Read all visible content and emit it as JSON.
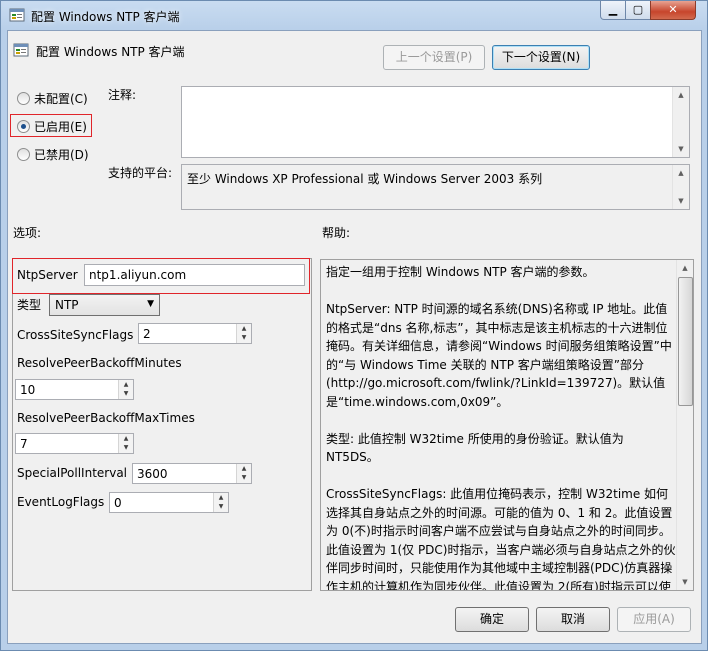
{
  "window": {
    "title": "配置 Windows NTP 客户端",
    "icon": "policy-settings-icon",
    "caption_buttons": {
      "minimize": "▁",
      "maximize": "▢",
      "close": "✕"
    }
  },
  "header": {
    "heading": "配置 Windows NTP 客户端",
    "prev_setting": "上一个设置(P)",
    "next_setting": "下一个设置(N)"
  },
  "state": {
    "not_configured": "未配置(C)",
    "enabled": "已启用(E)",
    "disabled": "已禁用(D)",
    "selected": "enabled"
  },
  "comment": {
    "label": "注释:",
    "value": ""
  },
  "platform": {
    "label": "支持的平台:",
    "value": "至少 Windows XP Professional 或 Windows Server 2003 系列"
  },
  "options": {
    "label": "选项:",
    "ntp_server": {
      "label": "NtpServer",
      "value": "ntp1.aliyun.com"
    },
    "type": {
      "label": "类型",
      "value": "NTP"
    },
    "cross_site_sync_flags": {
      "label": "CrossSiteSyncFlags",
      "value": "2"
    },
    "resolve_peer_backoff_minutes": {
      "label": "ResolvePeerBackoffMinutes",
      "value": "10"
    },
    "resolve_peer_backoff_max_times": {
      "label": "ResolvePeerBackoffMaxTimes",
      "value": "7"
    },
    "special_poll_interval": {
      "label": "SpecialPollInterval",
      "value": "3600"
    },
    "event_log_flags": {
      "label": "EventLogFlags",
      "value": "0"
    }
  },
  "help": {
    "label": "帮助:",
    "paragraphs": [
      "指定一组用于控制 Windows NTP 客户端的参数。",
      "NtpServer: NTP 时间源的域名系统(DNS)名称或 IP 地址。此值的格式是“dns 名称,标志”，其中标志是该主机标志的十六进制位掩码。有关详细信息，请参阅“Windows 时间服务组策略设置”中的“与 Windows Time 关联的 NTP 客户端组策略设置”部分(http://go.microsoft.com/fwlink/?LinkId=139727)。默认值是“time.windows.com,0x09”。",
      "类型: 此值控制 W32time 所使用的身份验证。默认值为 NT5DS。",
      "CrossSiteSyncFlags: 此值用位掩码表示，控制 W32time 如何选择其自身站点之外的时间源。可能的值为 0、1 和 2。此值设置为 0(不)时指示时间客户端不应尝试与自身站点之外的时间同步。此值设置为 1(仅 PDC)时指示，当客户端必须与自身站点之外的伙伴同步时间时，只能使用作为其他域中主域控制器(PDC)仿真器操作主机的计算机作为同步伙伴。此值设置为 2(所有)时指示可以使用任何同步伙伴。如果未设置 NT5DS 值，此值将被忽略。默认值为"
    ]
  },
  "footer": {
    "ok": "确定",
    "cancel": "取消",
    "apply": "应用(A)"
  },
  "colors": {
    "highlight_border": "#e0252a",
    "focus_border": "#3c7fb1"
  }
}
